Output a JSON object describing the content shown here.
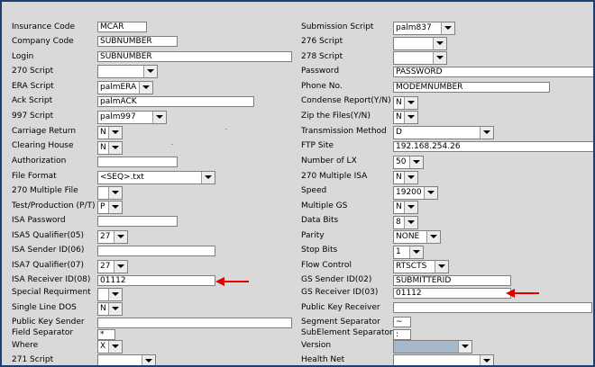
{
  "left": {
    "insurance_code": {
      "label": "Insurance Code",
      "value": "MCAR"
    },
    "company_code": {
      "label": "Company Code",
      "value": "SUBNUMBER"
    },
    "login": {
      "label": "Login",
      "value": "SUBNUMBER"
    },
    "script_270": {
      "label": "270 Script",
      "value": ""
    },
    "era_script": {
      "label": "ERA Script",
      "value": "palmERA"
    },
    "ack_script": {
      "label": "Ack Script",
      "value": "palmACK"
    },
    "script_997": {
      "label": "997 Script",
      "value": "palm997"
    },
    "carriage_return": {
      "label": "Carriage Return",
      "value": "N"
    },
    "clearing_house": {
      "label": "Clearing House",
      "value": "N"
    },
    "authorization": {
      "label": "Authorization",
      "value": ""
    },
    "file_format": {
      "label": "File Format",
      "value": "<SEQ>.txt"
    },
    "multiple_file_270": {
      "label": "270 Multiple File",
      "value": ""
    },
    "test_production": {
      "label": "Test/Production (P/T)",
      "value": "P"
    },
    "isa_password": {
      "label": "ISA Password",
      "value": ""
    },
    "isa5_qualifier": {
      "label": "ISA5 Qualifier(05)",
      "value": "27"
    },
    "isa_sender_id": {
      "label": "ISA Sender ID(06)",
      "value": ""
    },
    "isa7_qualifier": {
      "label": "ISA7 Qualifier(07)",
      "value": "27"
    },
    "isa_receiver_id": {
      "label": "ISA Receiver ID(08)",
      "value": "01112"
    },
    "special_requirement": {
      "label": "Special Requirment",
      "value": ""
    },
    "single_line_dos": {
      "label": "Single Line DOS",
      "value": "N"
    },
    "public_key_sender": {
      "label": "Public Key Sender",
      "value": ""
    },
    "field_separator": {
      "label": "Field Separator",
      "value": "*"
    },
    "where": {
      "label": "Where",
      "value": "X"
    },
    "script_271": {
      "label": "271 Script",
      "value": ""
    }
  },
  "right": {
    "submission_script": {
      "label": "Submission Script",
      "value": "palm837"
    },
    "script_276": {
      "label": "276 Script",
      "value": ""
    },
    "script_278": {
      "label": "278 Script",
      "value": ""
    },
    "password": {
      "label": "Password",
      "value": "PASSWORD"
    },
    "phone_no": {
      "label": "Phone No.",
      "value": "MODEMNUMBER"
    },
    "condense_report": {
      "label": "Condense Report(Y/N)",
      "value": "N"
    },
    "zip_files": {
      "label": "Zip the Files(Y/N)",
      "value": "N"
    },
    "transmission_method": {
      "label": "Transmission Method",
      "value": "D"
    },
    "ftp_site": {
      "label": "FTP Site",
      "value": "192.168.254.26"
    },
    "number_of_lx": {
      "label": "Number of LX",
      "value": "50"
    },
    "multiple_isa_270": {
      "label": "270 Multiple ISA",
      "value": "N"
    },
    "speed": {
      "label": "Speed",
      "value": "19200"
    },
    "multiple_gs": {
      "label": "Multiple GS",
      "value": "N"
    },
    "data_bits": {
      "label": "Data Bits",
      "value": "8"
    },
    "parity": {
      "label": "Parity",
      "value": "NONE"
    },
    "stop_bits": {
      "label": "Stop Bits",
      "value": "1"
    },
    "flow_control": {
      "label": "Flow Control",
      "value": "RTSCTS"
    },
    "gs_sender_id": {
      "label": "GS Sender ID(02)",
      "value": "SUBMITTERID"
    },
    "gs_receiver_id": {
      "label": "GS Receiver ID(03)",
      "value": "01112"
    },
    "public_key_receiver": {
      "label": "Public Key Receiver",
      "value": ""
    },
    "segment_separator": {
      "label": "Segment Separator",
      "value": "~"
    },
    "subelement_separator": {
      "label": "SubElement Separator",
      "value": ":"
    },
    "version": {
      "label": "Version",
      "value": ""
    },
    "health_net": {
      "label": "Health Net",
      "value": ""
    }
  },
  "colors": {
    "background": "#d9d9d9",
    "frame_border": "#1e3f73",
    "annotation_arrow": "#e00000",
    "version_selected": "#a6b8cc"
  }
}
